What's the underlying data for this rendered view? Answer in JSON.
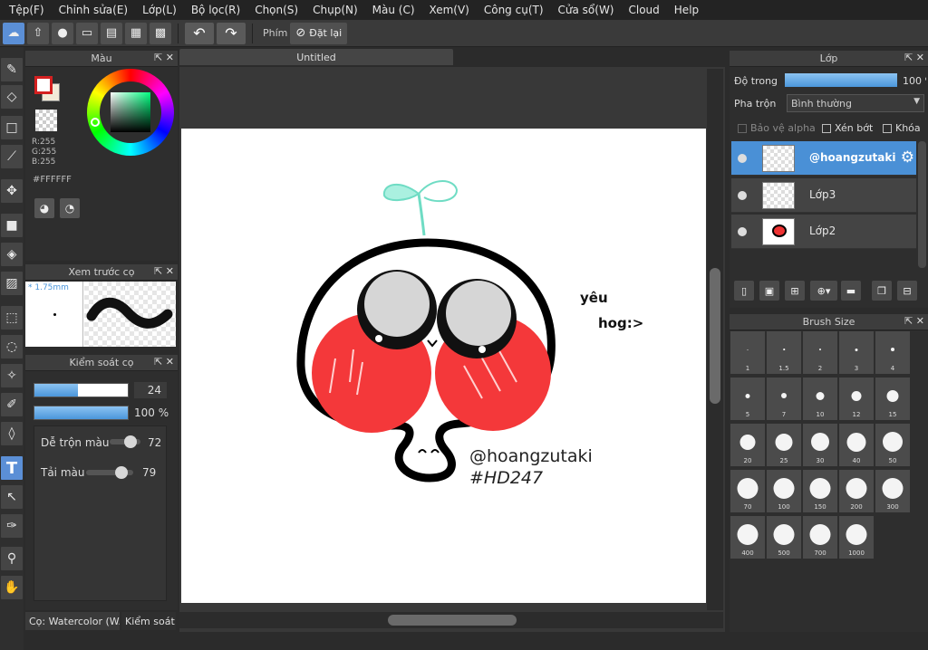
{
  "menu": [
    "Tệp(F)",
    "Chỉnh sửa(E)",
    "Lớp(L)",
    "Bộ lọc(R)",
    "Chọn(S)",
    "Chụp(N)",
    "Màu (C)",
    "Xem(V)",
    "Công cụ(T)",
    "Cửa sổ(W)",
    "Cloud",
    "Help"
  ],
  "toolbar": {
    "key_label": "Phím",
    "reset_label": "Đặt lại"
  },
  "color_panel": {
    "title": "Màu",
    "rgb": [
      "R:255",
      "G:255",
      "B:255"
    ],
    "hex": "#FFFFFF",
    "fg_color": "#FFFFFF",
    "bg_color": "#F2EAD8"
  },
  "brush_preview": {
    "title": "Xem trước cọ",
    "size": "* 1.75mm"
  },
  "brush_control": {
    "title": "Kiểm soát cọ",
    "size_value": "24",
    "size_fill": 0.47,
    "opacity_value": "100 %",
    "opacity_fill": 1.0,
    "blend_label": "Dễ trộn màu",
    "blend_value": "72",
    "load_label": "Tải màu",
    "load_value": "79"
  },
  "bottom_tabs": [
    "Cọ: Watercolor (W...",
    "Kiểm soát c"
  ],
  "document": {
    "tab_title": "Untitled"
  },
  "artwork": {
    "text_lines": [
      "@hoangzutaki",
      "#HD247"
    ],
    "handwriting": [
      "yêu",
      "hog:>"
    ]
  },
  "layer_panel": {
    "title": "Lớp",
    "opacity_label": "Độ trong",
    "opacity_value": "100 %",
    "blend_label": "Pha trộn",
    "blend_value": "Bình thường",
    "protect_alpha": "Bảo vệ alpha",
    "clipping": "Xén bớt",
    "lock": "Khóa",
    "layers": [
      {
        "name": "@hoangzutaki",
        "selected": true
      },
      {
        "name": "Lớp3",
        "selected": false
      },
      {
        "name": "Lớp2",
        "selected": false
      }
    ]
  },
  "brush_size_panel": {
    "title": "Brush Size",
    "sizes": [
      "1",
      "1.5",
      "2",
      "3",
      "4",
      "5",
      "7",
      "10",
      "12",
      "15",
      "20",
      "25",
      "30",
      "40",
      "50",
      "70",
      "100",
      "150",
      "200",
      "300",
      "400",
      "500",
      "700",
      "1000"
    ]
  }
}
